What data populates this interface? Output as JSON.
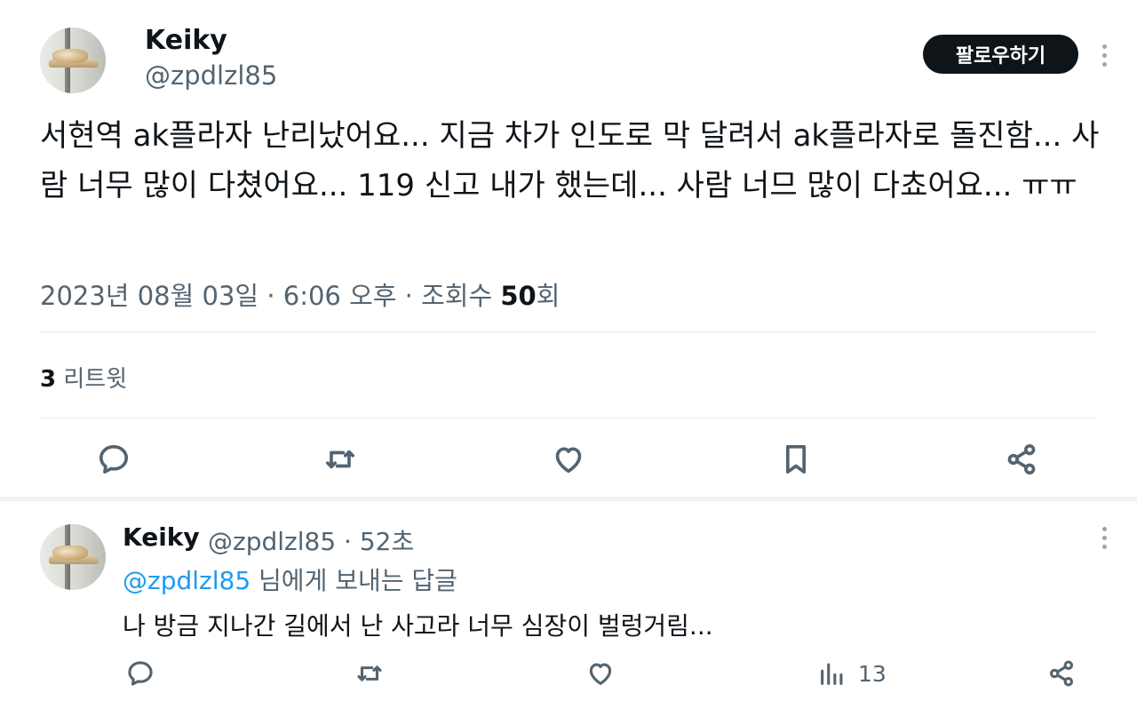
{
  "tweet": {
    "author": {
      "name": "Keiky",
      "handle": "@zpdlzl85"
    },
    "follow_label": "팔로우하기",
    "text": "서현역 ak플라자 난리났어요... 지금 차가 인도로 막 달려서 ak플라자로 돌진함... 사람 너무 많이 다쳤어요... 119 신고 내가 했는데... 사람 너므 많이 다쵸어요... ㅠㅠ",
    "date": "2023년 08월 03일",
    "separator": "·",
    "time": "6:06 오후",
    "views_label": "조회수",
    "views_count": "50",
    "views_unit": "회",
    "retweet_count": "3",
    "retweet_label": "리트윗",
    "actions": [
      "reply-icon",
      "retweet-icon",
      "like-icon",
      "bookmark-icon",
      "share-icon"
    ]
  },
  "reply": {
    "author": {
      "name": "Keiky",
      "handle": "@zpdlzl85"
    },
    "separator": "·",
    "age": "52초",
    "replying_to": "@zpdlzl85",
    "replying_suffix": "님에게 보내는 답글",
    "text": "나 방금 지나간 길에서 난 사고라 너무 심장이 벌렁거림...",
    "views": "13",
    "actions": [
      "reply-icon",
      "retweet-icon",
      "like-icon",
      "views-icon",
      "share-icon"
    ]
  },
  "colors": {
    "text": "#0f1419",
    "secondary": "#536471",
    "link": "#1d9bf0",
    "divider": "#e6eaee"
  }
}
